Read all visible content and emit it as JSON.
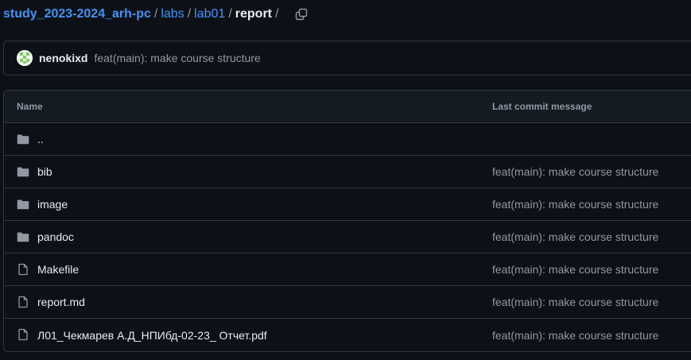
{
  "breadcrumb": {
    "repo": "study_2023-2024_arh-pc",
    "sep": "/",
    "items": [
      "labs",
      "lab01"
    ],
    "current": "report",
    "copy_icon": "copy-icon"
  },
  "latest_commit": {
    "author": "nenokixd",
    "message": "feat(main): make course structure"
  },
  "table": {
    "headers": {
      "name": "Name",
      "message": "Last commit message"
    },
    "rows": [
      {
        "name": "..",
        "type": "folder",
        "message": ""
      },
      {
        "name": "bib",
        "type": "folder",
        "message": "feat(main): make course structure"
      },
      {
        "name": "image",
        "type": "folder",
        "message": "feat(main): make course structure"
      },
      {
        "name": "pandoc",
        "type": "folder",
        "message": "feat(main): make course structure"
      },
      {
        "name": "Makefile",
        "type": "file",
        "message": "feat(main): make course structure"
      },
      {
        "name": "report.md",
        "type": "file",
        "message": "feat(main): make course structure"
      },
      {
        "name": "Л01_Чекмарев А.Д_НПИбд-02-23_ Отчет.pdf",
        "type": "file",
        "message": "feat(main): make course structure"
      }
    ]
  },
  "colors": {
    "background": "#0d1117",
    "link": "#4493f8",
    "muted": "#9198a1",
    "border": "#30363d",
    "icon": "#9198a1"
  }
}
